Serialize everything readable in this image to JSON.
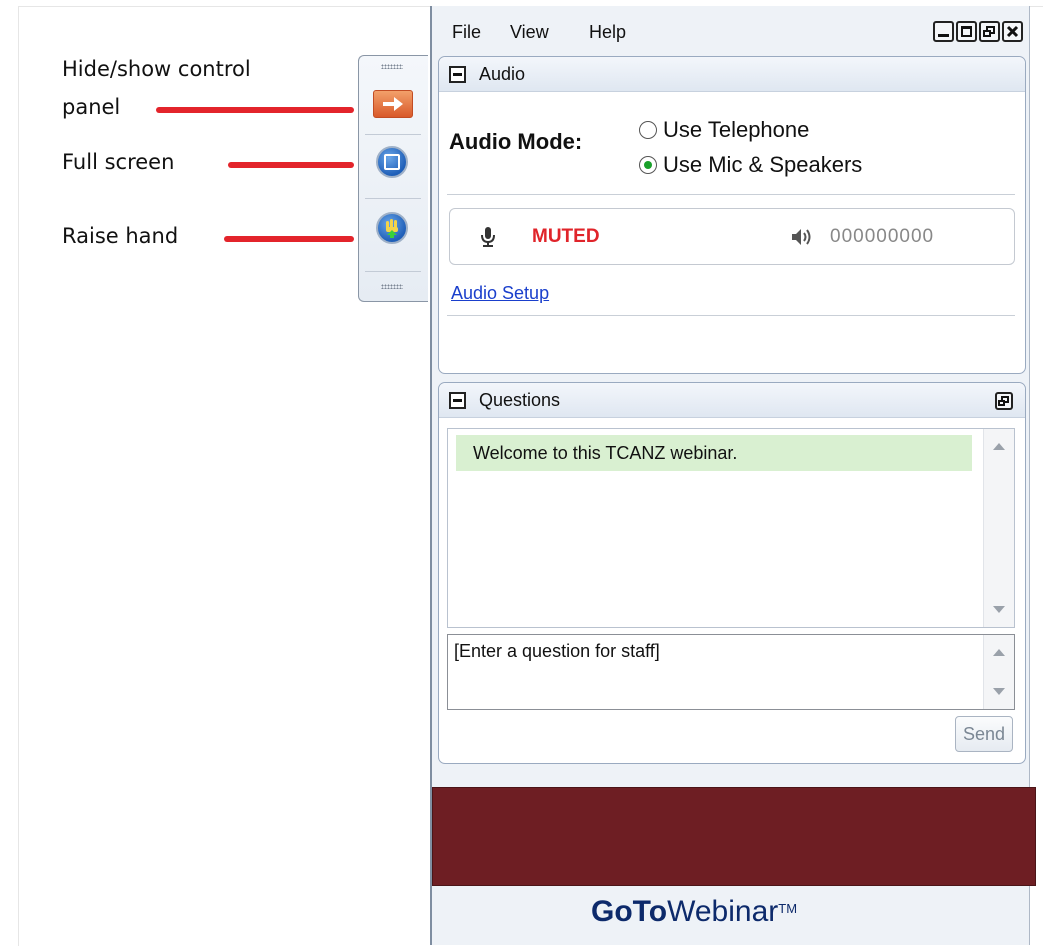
{
  "annotations": {
    "hide_show": [
      "Hide/show control",
      "panel"
    ],
    "full_screen": "Full screen",
    "raise_hand": "Raise hand"
  },
  "menu": {
    "file": "File",
    "view": "View",
    "help": "Help"
  },
  "audio": {
    "title": "Audio",
    "mode_label": "Audio Mode:",
    "options": [
      "Use Telephone",
      "Use Mic & Speakers"
    ],
    "selected_option": "Use Mic & Speakers",
    "status": "MUTED",
    "audio_pin": "000000000",
    "setup_link": "Audio Setup"
  },
  "questions": {
    "title": "Questions",
    "messages": [
      "Welcome to this TCANZ webinar."
    ],
    "input_placeholder": "[Enter a question for staff]",
    "send_label": "Send"
  },
  "brand": {
    "go_to": "GoTo",
    "webinar": "Webinar",
    "tm": "TM"
  },
  "colors": {
    "accent_red": "#e3242b",
    "muted_red": "#e0242a",
    "link_blue": "#1a3fcc",
    "redaction": "#6e1e23",
    "welcome_bg": "#d9f0d1"
  }
}
